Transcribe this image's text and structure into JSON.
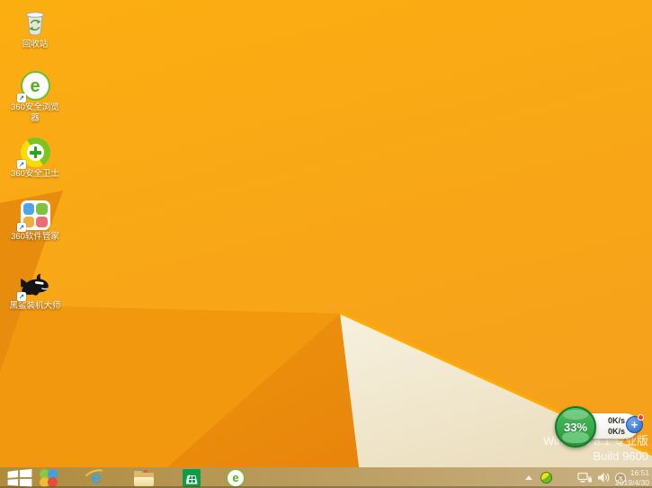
{
  "wallpaper": {
    "base_color": "#F8A716",
    "cream_color": "#F2EAD2",
    "fold_highlight": "#FFAD06"
  },
  "desktop_icons": [
    {
      "label": "回收站"
    },
    {
      "label": "360安全浏览器"
    },
    {
      "label": "360安全卫士"
    },
    {
      "label": "360软件管家"
    },
    {
      "label": "黑鲨装机大师"
    }
  ],
  "icon_glyphs": {
    "shortcut_arrow": "↗",
    "ie_letter": "e",
    "green_e_letter": "e"
  },
  "taskbar": {
    "icons": [
      "start",
      "colorful-ball",
      "internet-explorer",
      "file-explorer",
      "windows-store",
      "360-browser"
    ]
  },
  "tray": {
    "time": "16:51",
    "date": "2019/4/30"
  },
  "watermark": {
    "line1": "Windows 8.1 专业版",
    "line2": "Build 9600"
  },
  "net_widget": {
    "percent": "33%",
    "up_arrow": "↑",
    "up": "0K/s",
    "down_arrow": "↓",
    "down": "0K/s",
    "plus": "+"
  }
}
